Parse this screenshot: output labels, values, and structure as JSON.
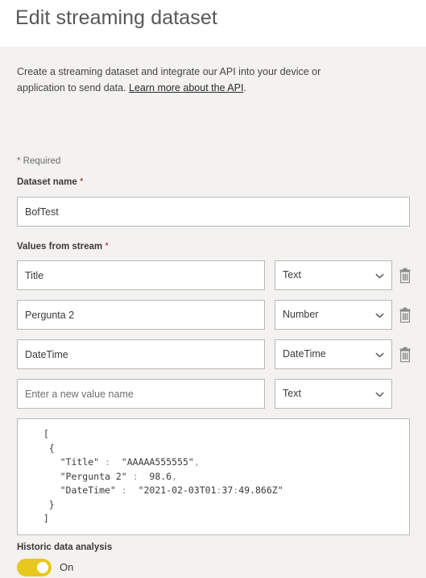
{
  "header": {
    "title": "Edit streaming dataset"
  },
  "intro": {
    "text_before_link": "Create a streaming dataset and integrate our API into your device or application to send data. ",
    "link_label": "Learn more about the API",
    "text_after_link": "."
  },
  "form": {
    "required_note": "* Required",
    "dataset_name": {
      "label": "Dataset name",
      "required_marker": "*",
      "value": "BofTest"
    },
    "values_from_stream": {
      "label": "Values from stream",
      "required_marker": "*",
      "rows": [
        {
          "name": "Title",
          "name_placeholder": "",
          "type": "Text",
          "has_delete": true,
          "delete_label": "Delete value"
        },
        {
          "name": "Pergunta 2",
          "name_placeholder": "",
          "type": "Number",
          "has_delete": true,
          "delete_label": "Delete value"
        },
        {
          "name": "DateTime",
          "name_placeholder": "",
          "type": "DateTime",
          "has_delete": true,
          "delete_label": "Delete value"
        },
        {
          "name": "",
          "name_placeholder": "Enter a new value name",
          "type": "Text",
          "has_delete": false,
          "delete_label": ""
        }
      ],
      "type_options": [
        "Text",
        "Number",
        "DateTime"
      ]
    },
    "json_preview": {
      "lines": [
        "  [",
        "   {",
        "     \"Title\" :  \"AAAAA555555\",",
        "     \"Pergunta 2\" :  98.6,",
        "     \"DateTime\" :  \"2021-02-03T01:37:49.866Z\"",
        "   }",
        "  ]"
      ]
    },
    "historic_data_analysis": {
      "label": "Historic data analysis",
      "state_label": "On",
      "is_on": true,
      "accent_color": "#e8c81c"
    }
  },
  "icons": {
    "chevron": "chevron-down-icon",
    "trash": "trash-icon"
  }
}
